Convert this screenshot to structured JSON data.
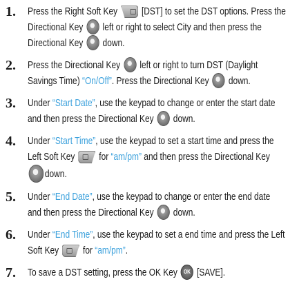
{
  "steps": [
    {
      "number": "1.",
      "lines": [
        [
          "Press the Right Soft Key ",
          {
            "icon": "right-soft-key-icon"
          },
          " [DST] to set the DST options. Press the"
        ],
        [
          "Directional Key ",
          {
            "icon": "directional-key-icon"
          },
          " left or right to select City and then press the"
        ],
        [
          "Directional Key ",
          {
            "icon": "directional-key-icon"
          },
          " down."
        ]
      ]
    },
    {
      "number": "2.",
      "lines": [
        [
          "Press the Directional Key ",
          {
            "icon": "directional-key-icon"
          },
          " left or right to turn DST (Daylight"
        ],
        [
          "Savings Time) ",
          {
            "hl": "“On/Off”"
          },
          ". Press the Directional Key ",
          {
            "icon": "directional-key-icon"
          },
          " down."
        ]
      ]
    },
    {
      "number": "3.",
      "lines": [
        [
          "Under ",
          {
            "hl": "“Start Date”"
          },
          ", use the keypad to change or enter the start date"
        ],
        [
          "and then press the Directional Key ",
          {
            "icon": "directional-key-icon"
          },
          " down."
        ]
      ]
    },
    {
      "number": "4.",
      "lines": [
        [
          "Under ",
          {
            "hl": "“Start Time”"
          },
          ", use the keypad to set a start time and press the"
        ],
        [
          "Left Soft Key ",
          {
            "icon": "left-soft-key-icon"
          },
          " for ",
          {
            "hl": "“am/pm”"
          },
          " and then press the Directional Key"
        ],
        [
          {
            "icon": "directional-key-icon-large"
          },
          "down."
        ]
      ]
    },
    {
      "number": "5.",
      "lines": [
        [
          "Under ",
          {
            "hl": "“End Date”"
          },
          ", use the keypad to change or enter the end date"
        ],
        [
          "and then press the Directional Key ",
          {
            "icon": "directional-key-icon"
          },
          " down."
        ]
      ]
    },
    {
      "number": "6.",
      "lines": [
        [
          "Under ",
          {
            "hl": "“End Time”"
          },
          ", use the keypad to set a end time and press the Left"
        ],
        [
          "Soft Key ",
          {
            "icon": "left-soft-key-icon"
          },
          " for ",
          {
            "hl": "“am/pm”"
          },
          "."
        ]
      ]
    },
    {
      "number": "7.",
      "lines": [
        [
          "To save a DST setting, press the OK Key ",
          {
            "icon": "ok-key-icon",
            "label": "OK"
          },
          " [SAVE]."
        ]
      ]
    }
  ],
  "colors": {
    "text": "#1a1a1a",
    "highlight": "#3aa0dc"
  }
}
